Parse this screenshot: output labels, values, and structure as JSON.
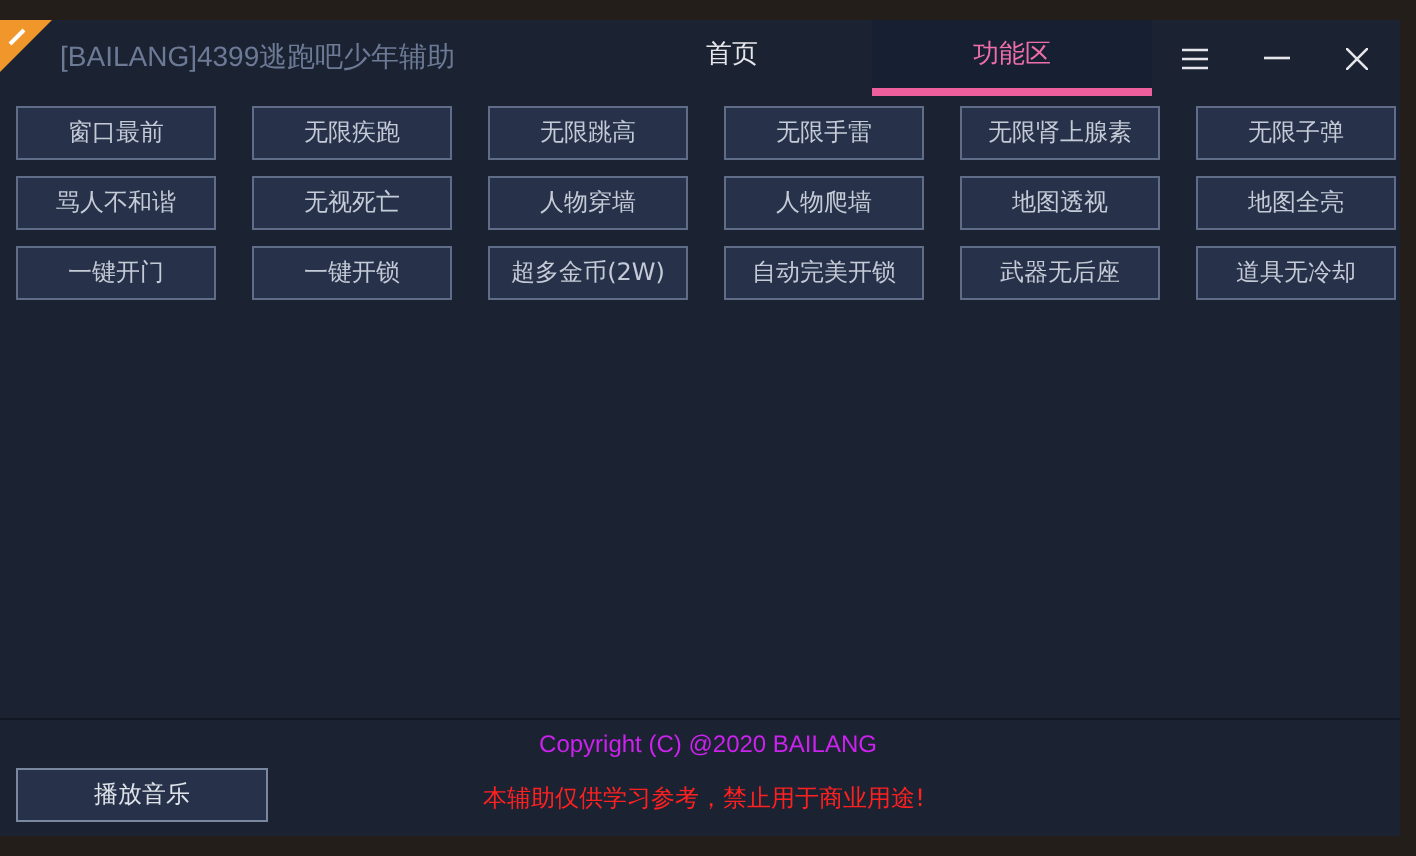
{
  "window": {
    "title": "[BAILANG]4399逃跑吧少年辅助"
  },
  "tabs": [
    {
      "label": "首页",
      "selected": false
    },
    {
      "label": "功能区",
      "selected": true
    }
  ],
  "feature_buttons": [
    "窗口最前",
    "无限疾跑",
    "无限跳高",
    "无限手雷",
    "无限肾上腺素",
    "无限子弹",
    "骂人不和谐",
    "无视死亡",
    "人物穿墙",
    "人物爬墙",
    "地图透视",
    "地图全亮",
    "一键开门",
    "一键开锁",
    "超多金币(2W)",
    "自动完美开锁",
    "武器无后座",
    "道具无冷却"
  ],
  "footer": {
    "copyright": "Copyright (C) @2020 BAILANG",
    "music_button": "播放音乐",
    "notice": "本辅助仅供学习参考，禁止用于商业用途!"
  }
}
